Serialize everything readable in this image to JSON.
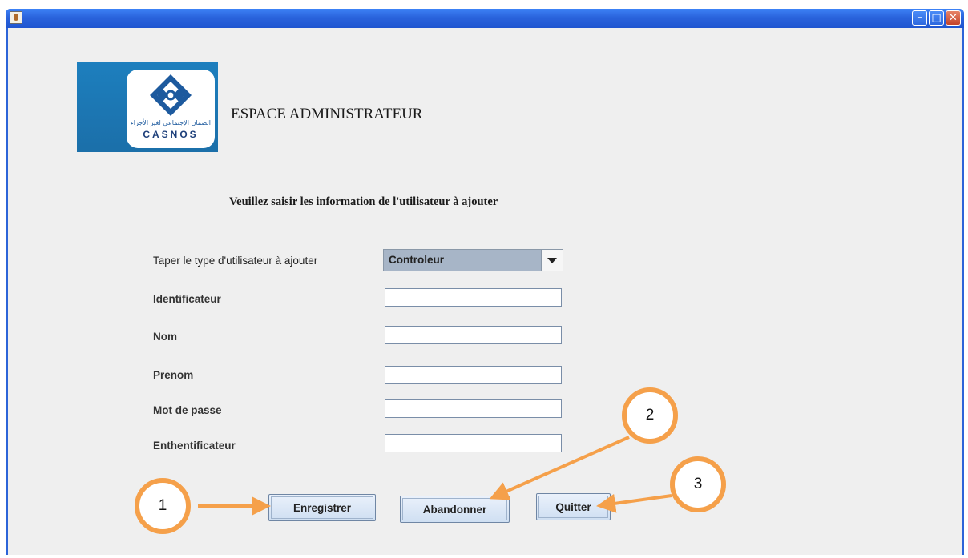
{
  "window": {
    "icon": "java-cup-icon",
    "controls": [
      "minimize",
      "maximize",
      "close"
    ]
  },
  "logo": {
    "arabic": "الضمان الإجتماعي لغير الأجراء",
    "text": "CASNOS"
  },
  "header": {
    "title": "ESPACE ADMINISTRATEUR"
  },
  "form": {
    "subtitle": "Veuillez saisir les information de l'utilisateur à ajouter",
    "type_label": "Taper le type d'utilisateur à ajouter",
    "type_value": "Controleur",
    "fields": [
      {
        "label": "Identificateur",
        "value": ""
      },
      {
        "label": "Nom",
        "value": ""
      },
      {
        "label": "Prenom",
        "value": ""
      },
      {
        "label": "Mot de passe",
        "value": ""
      },
      {
        "label": "Enthentificateur",
        "value": ""
      }
    ]
  },
  "buttons": {
    "save": "Enregistrer",
    "cancel": "Abandonner",
    "quit": "Quitter"
  },
  "callouts": [
    "1",
    "2",
    "3"
  ],
  "colors": {
    "accent": "#f5a04a",
    "titlebar": "#2a63dc",
    "logo_bg": "#1b6fa9"
  }
}
